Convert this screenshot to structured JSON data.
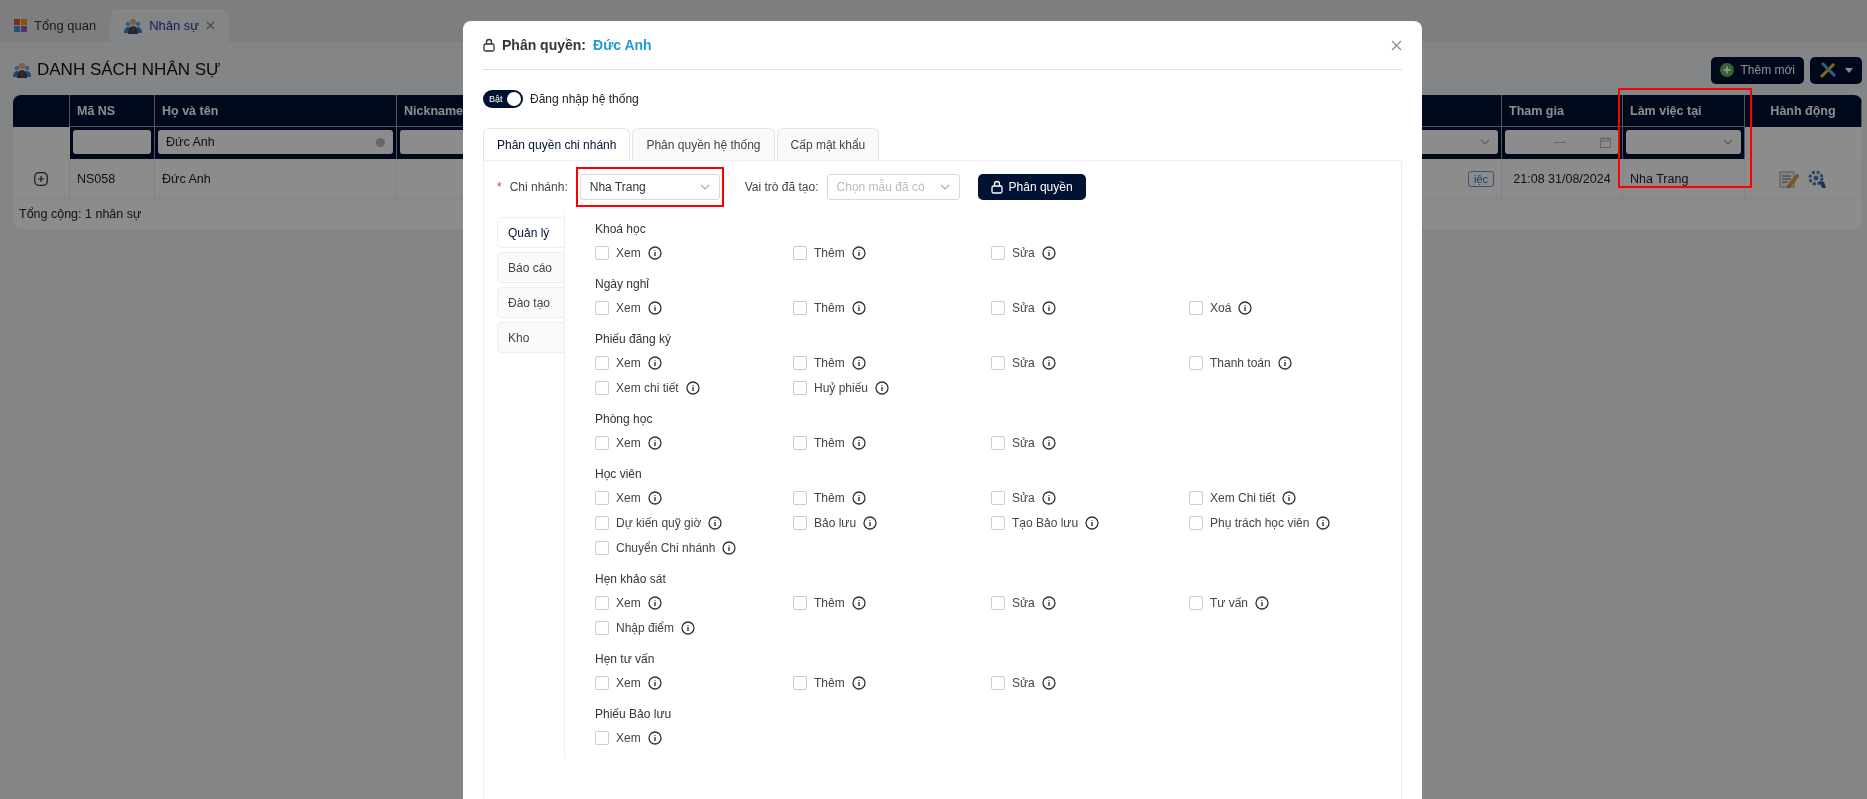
{
  "app_tabs": [
    {
      "label": "Tổng quan",
      "selected": false,
      "closable": false
    },
    {
      "label": "Nhân sự",
      "selected": true,
      "closable": true
    }
  ],
  "page_title": "DANH SÁCH NHÂN SỰ",
  "toolbar": {
    "add_button": "Thêm mới"
  },
  "table": {
    "columns": [
      {
        "kind": "expand"
      },
      {
        "kind": "text",
        "label": "Mã NS",
        "filter": {
          "kind": "text"
        }
      },
      {
        "kind": "text",
        "label": "Họ và tên",
        "filter": {
          "kind": "text",
          "value": "Đức Anh"
        }
      },
      {
        "kind": "text",
        "label": "Nickname",
        "filter": {
          "kind": "text"
        }
      },
      {
        "kind": "tag",
        "filter": {
          "kind": "select"
        }
      },
      {
        "kind": "date",
        "label": "Tham gia",
        "filter": {
          "kind": "date_range"
        }
      },
      {
        "kind": "text",
        "label": "Làm việc tại",
        "filter": {
          "kind": "select"
        }
      },
      {
        "kind": "actions",
        "label": "Hành động"
      }
    ],
    "rows": [
      {
        "cells": [
          null,
          "NS058",
          "Đức Anh",
          null,
          "iệc",
          "21:08 31/08/2024",
          "Nha Trang",
          null
        ]
      }
    ],
    "footer": "Tổng cộng: 1 nhân sự"
  },
  "modal": {
    "title": "Phân quyền:",
    "subject": "Đức Anh",
    "login_toggle": {
      "on": true,
      "text": "Bật",
      "label": "Đăng nhập hệ thống"
    },
    "tabs": [
      {
        "label": "Phân quyền chi nhánh",
        "selected": true
      },
      {
        "label": "Phân quyền hệ thống",
        "selected": false
      },
      {
        "label": "Cấp mật khẩu",
        "selected": false
      }
    ],
    "branch": {
      "required_mark": "*",
      "label": "Chi nhánh:",
      "value": "Nha Trang"
    },
    "role": {
      "label": "Vai trò đã tạo:",
      "placeholder": "Chọn mẫu đã có"
    },
    "grant_button": "Phân quyền",
    "side_tabs": [
      {
        "label": "Quản lý",
        "selected": true
      },
      {
        "label": "Báo cáo",
        "selected": false
      },
      {
        "label": "Đào tạo",
        "selected": false
      },
      {
        "label": "Kho",
        "selected": false
      }
    ],
    "sections": [
      {
        "title": "Khoá học",
        "items": [
          {
            "label": "Xem",
            "checked": false
          },
          {
            "label": "Thêm",
            "checked": false
          },
          {
            "label": "Sửa",
            "checked": false
          }
        ]
      },
      {
        "title": "Ngày nghỉ",
        "items": [
          {
            "label": "Xem",
            "checked": false
          },
          {
            "label": "Thêm",
            "checked": false
          },
          {
            "label": "Sửa",
            "checked": false
          },
          {
            "label": "Xoá",
            "checked": false
          }
        ]
      },
      {
        "title": "Phiếu đăng ký",
        "items": [
          {
            "label": "Xem",
            "checked": false
          },
          {
            "label": "Thêm",
            "checked": false
          },
          {
            "label": "Sửa",
            "checked": false
          },
          {
            "label": "Thanh toán",
            "checked": false
          },
          {
            "label": "Xem chi tiết",
            "checked": false
          },
          {
            "label": "Huỷ phiếu",
            "checked": false
          }
        ]
      },
      {
        "title": "Phòng học",
        "items": [
          {
            "label": "Xem",
            "checked": false
          },
          {
            "label": "Thêm",
            "checked": false
          },
          {
            "label": "Sửa",
            "checked": false
          }
        ]
      },
      {
        "title": "Học viên",
        "items": [
          {
            "label": "Xem",
            "checked": false
          },
          {
            "label": "Thêm",
            "checked": false
          },
          {
            "label": "Sửa",
            "checked": false
          },
          {
            "label": "Xem Chi tiết",
            "checked": false
          },
          {
            "label": "Dự kiến quỹ giờ",
            "checked": false
          },
          {
            "label": "Bảo lưu",
            "checked": false
          },
          {
            "label": "Tạo Bảo lưu",
            "checked": false
          },
          {
            "label": "Phụ trách học viên",
            "checked": false
          },
          {
            "label": "Chuyển Chi nhánh",
            "checked": false
          }
        ]
      },
      {
        "title": "Hẹn khảo sát",
        "items": [
          {
            "label": "Xem",
            "checked": false
          },
          {
            "label": "Thêm",
            "checked": false
          },
          {
            "label": "Sửa",
            "checked": false
          },
          {
            "label": "Tư vấn",
            "checked": false
          },
          {
            "label": "Nhập điểm",
            "checked": false
          }
        ]
      },
      {
        "title": "Hẹn tư vấn",
        "items": [
          {
            "label": "Xem",
            "checked": false
          },
          {
            "label": "Thêm",
            "checked": false
          },
          {
            "label": "Sửa",
            "checked": false
          }
        ]
      },
      {
        "title": "Phiếu Bảo lưu",
        "items": [
          {
            "label": "Xem",
            "checked": false
          }
        ]
      }
    ]
  }
}
